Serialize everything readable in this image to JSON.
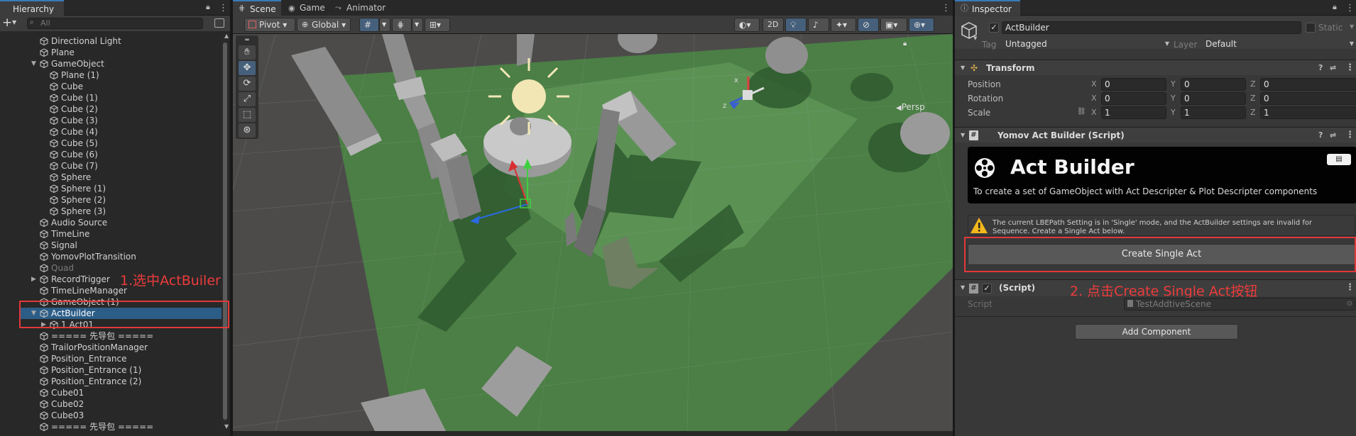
{
  "hierarchy": {
    "tab": "Hierarchy",
    "search_placeholder": "All",
    "add_label": "+",
    "items": [
      {
        "label": "Directional Light",
        "indent": 1
      },
      {
        "label": "Plane",
        "indent": 1
      },
      {
        "label": "GameObject",
        "indent": 1,
        "expanded": true
      },
      {
        "label": "Plane (1)",
        "indent": 2
      },
      {
        "label": "Cube",
        "indent": 2
      },
      {
        "label": "Cube (1)",
        "indent": 2
      },
      {
        "label": "Cube (2)",
        "indent": 2
      },
      {
        "label": "Cube (3)",
        "indent": 2
      },
      {
        "label": "Cube (4)",
        "indent": 2
      },
      {
        "label": "Cube (5)",
        "indent": 2
      },
      {
        "label": "Cube (6)",
        "indent": 2
      },
      {
        "label": "Cube (7)",
        "indent": 2
      },
      {
        "label": "Sphere",
        "indent": 2
      },
      {
        "label": "Sphere (1)",
        "indent": 2
      },
      {
        "label": "Sphere (2)",
        "indent": 2
      },
      {
        "label": "Sphere (3)",
        "indent": 2
      },
      {
        "label": "Audio Source",
        "indent": 1
      },
      {
        "label": "TimeLine",
        "indent": 1
      },
      {
        "label": "Signal",
        "indent": 1
      },
      {
        "label": "YomovPlotTransition",
        "indent": 1
      },
      {
        "label": "Quad",
        "indent": 1,
        "dim": true
      },
      {
        "label": "RecordTrigger",
        "indent": 1,
        "collapsed": true
      },
      {
        "label": "TimeLineManager",
        "indent": 1
      },
      {
        "label": "GameObject (1)",
        "indent": 1
      },
      {
        "label": "ActBuilder",
        "indent": 1,
        "expanded": true,
        "selected": true
      },
      {
        "label": "1 Act01",
        "indent": 2,
        "collapsed": true
      },
      {
        "label": "===== 先导包 =====",
        "indent": 1
      },
      {
        "label": "TrailorPositionManager",
        "indent": 1
      },
      {
        "label": "Position_Entrance",
        "indent": 1
      },
      {
        "label": "Position_Entrance (1)",
        "indent": 1
      },
      {
        "label": "Position_Entrance (2)",
        "indent": 1
      },
      {
        "label": "Cube01",
        "indent": 1
      },
      {
        "label": "Cube02",
        "indent": 1
      },
      {
        "label": "Cube03",
        "indent": 1
      },
      {
        "label": "===== 先导包 =====",
        "indent": 1
      }
    ]
  },
  "annotations": {
    "step1": "1.选中ActBuiler",
    "step2": "2. 点击Create Single Act按钮"
  },
  "scene": {
    "tabs": [
      "Scene",
      "Game",
      "Animator"
    ],
    "pivot": "Pivot",
    "global": "Global",
    "mode_2d": "2D",
    "persp": "Persp"
  },
  "inspector": {
    "tab": "Inspector",
    "object_name": "ActBuilder",
    "static_label": "Static",
    "tag_label": "Tag",
    "tag_value": "Untagged",
    "layer_label": "Layer",
    "layer_value": "Default",
    "transform": {
      "title": "Transform",
      "rows": [
        {
          "label": "Position",
          "x": "0",
          "y": "0",
          "z": "0"
        },
        {
          "label": "Rotation",
          "x": "0",
          "y": "0",
          "z": "0"
        },
        {
          "label": "Scale",
          "x": "1",
          "y": "1",
          "z": "1"
        }
      ]
    },
    "script_component": {
      "title": "Yomov Act Builder (Script)",
      "banner_title": "Act Builder",
      "banner_desc": "To create a set of GameObject with Act Descripter & Plot Descripter components",
      "warning": "The current LBEPath Setting is in 'Single' mode, and the ActBuilder settings are invalid for Sequence. Create a Single Act below.",
      "button": "Create Single Act"
    },
    "second_component": {
      "title": "(Script)",
      "script_label": "Script",
      "script_value": "TestAddtiveScene"
    },
    "add_component": "Add Component"
  },
  "colors": {
    "selection": "#2c5d87",
    "annotation_red": "#e2393b",
    "ground_green": "#4f8a48",
    "panel": "#383838"
  }
}
